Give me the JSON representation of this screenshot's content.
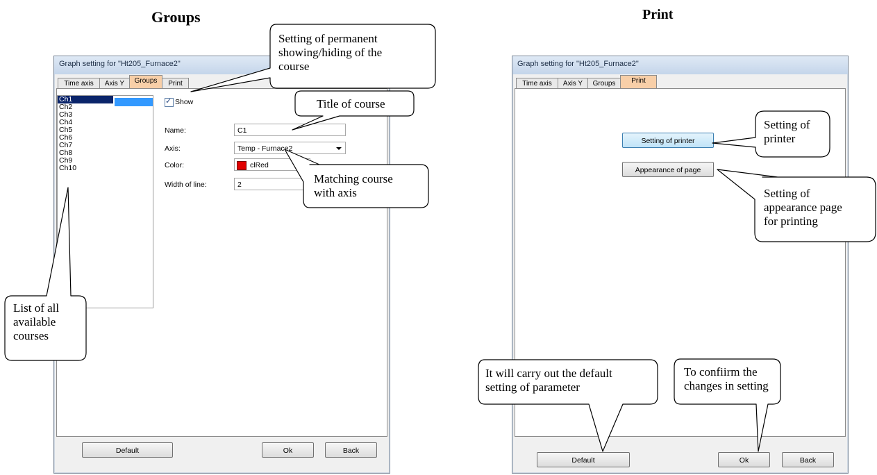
{
  "headings": {
    "left": "Groups",
    "right": "Print"
  },
  "left_window": {
    "title": "Graph setting for \"Ht205_Furnace2\"",
    "tabs": [
      "Time axis",
      "Axis Y",
      "Groups",
      "Print"
    ],
    "active_tab": "Groups",
    "channels": [
      "Ch1",
      "Ch2",
      "Ch3",
      "Ch4",
      "Ch5",
      "Ch6",
      "Ch7",
      "Ch8",
      "Ch9",
      "Ch10"
    ],
    "selected_channel": "Ch1",
    "show_label": "Show",
    "show_checked": true,
    "name_label": "Name:",
    "name_value": "C1",
    "axis_label": "Axis:",
    "axis_value": "Temp - Furnace2",
    "color_label": "Color:",
    "color_value": "clRed",
    "color_hex": "#e00000",
    "width_label": "Width of line:",
    "width_value": "2",
    "buttons": {
      "default": "Default",
      "ok": "Ok",
      "back": "Back"
    }
  },
  "right_window": {
    "title": "Graph setting for \"Ht205_Furnace2\"",
    "tabs": [
      "Time axis",
      "Axis Y",
      "Groups",
      "Print"
    ],
    "active_tab": "Print",
    "setting_of_printer": "Setting of printer",
    "appearance_of_page": "Appearance of page",
    "buttons": {
      "default": "Default",
      "ok": "Ok",
      "back": "Back"
    }
  },
  "callouts": {
    "permanent": [
      "Setting of permanent",
      "showing/hiding  of the",
      "course"
    ],
    "title_of_course": [
      "Title of course"
    ],
    "matching": [
      "Matching course",
      "with axis"
    ],
    "list_all": [
      "List of all",
      "available",
      "courses"
    ],
    "printer": [
      "Setting of",
      "printer"
    ],
    "appearance": [
      "Setting of",
      "appearance page",
      "for printing"
    ],
    "default": [
      "It will carry out the default",
      "setting of parameter"
    ],
    "confirm": [
      "To confiirm the",
      "changes in setting"
    ]
  }
}
